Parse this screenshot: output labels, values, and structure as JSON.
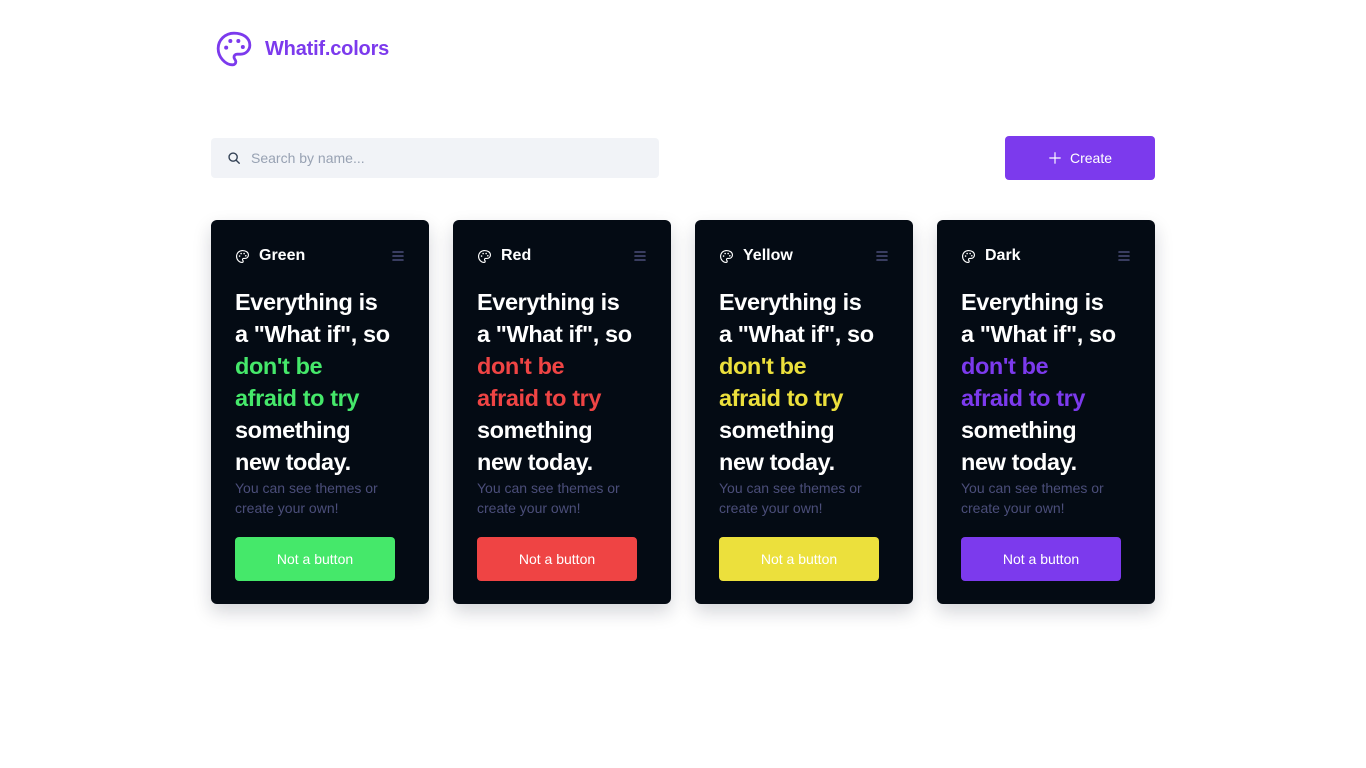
{
  "brand": {
    "name": "Whatif.colors",
    "icon": "palette-icon",
    "color": "#7c3aed"
  },
  "search": {
    "placeholder": "Search by name...",
    "value": "",
    "icon": "search-icon"
  },
  "toolbar": {
    "create_label": "Create",
    "create_icon": "plus-icon"
  },
  "headline": {
    "line1": "Everything is",
    "line2": "a \"What if\", so",
    "line3": "don't be",
    "line4": "afraid to try",
    "line5": "something",
    "line6": "new today."
  },
  "cards": [
    {
      "title": "Green",
      "accent": "#45e86a",
      "subtitle": "You can see themes or create your own!",
      "button_label": "Not a button"
    },
    {
      "title": "Red",
      "accent": "#ef4444",
      "subtitle": "You can see themes or create your own!",
      "button_label": "Not a button"
    },
    {
      "title": "Yellow",
      "accent": "#ece03c",
      "subtitle": "You can see themes or create your own!",
      "button_label": "Not a button"
    },
    {
      "title": "Dark",
      "accent": "#7c3aed",
      "subtitle": "You can see themes or create your own!",
      "button_label": "Not a button"
    }
  ],
  "colors": {
    "card_background": "#040b14",
    "search_background": "#f1f3f7",
    "primary": "#7c3aed"
  }
}
